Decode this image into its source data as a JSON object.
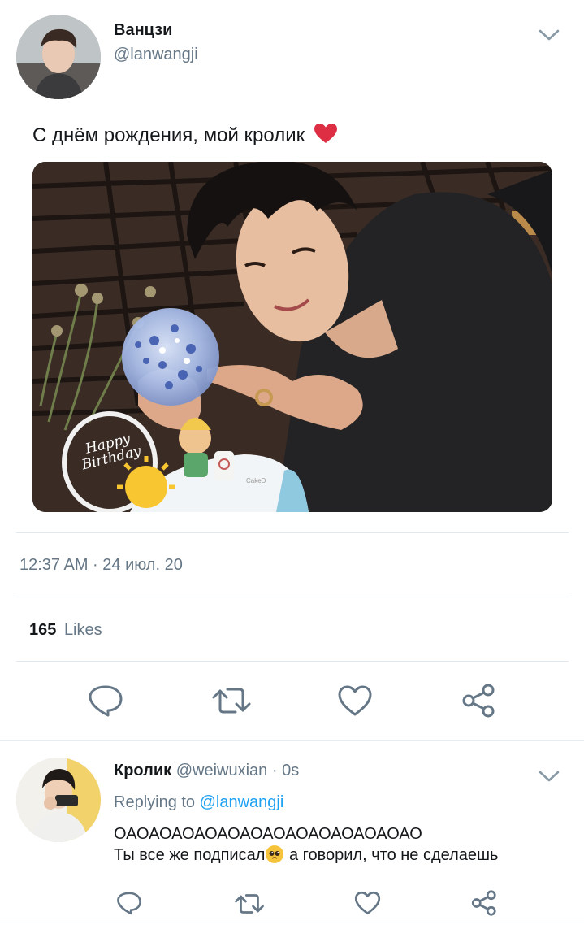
{
  "tweet": {
    "display_name": "Ванцзи",
    "handle": "@lanwangji",
    "text": "С днём рождения, мой кролик",
    "heart_emoji": "❤️",
    "timestamp": "12:37 AM · 24 июл. 20",
    "likes_count": "165",
    "likes_label": "Likes",
    "image_text": "Happy Birthday",
    "cake_label": "CakeD"
  },
  "reply": {
    "display_name": "Кролик",
    "handle": "@weiwuxian",
    "time": "· 0s",
    "replying_prefix": "Replying to",
    "replying_handle": "@lanwangji",
    "line1": "ОАОАОАОАОАОАОАОАОАОАОАОАОАО",
    "line2_before": "Ты все же подписал",
    "line2_after": " а говорил, что не сделаешь"
  },
  "icons": {
    "reply": "reply-icon",
    "retweet": "retweet-icon",
    "like": "heart-icon",
    "share": "share-icon",
    "menu": "chevron-down-icon"
  },
  "colors": {
    "text": "#14171a",
    "secondary": "#657786",
    "link": "#1da1f2",
    "heart": "#e0245e",
    "divider": "#e1e8ed"
  }
}
